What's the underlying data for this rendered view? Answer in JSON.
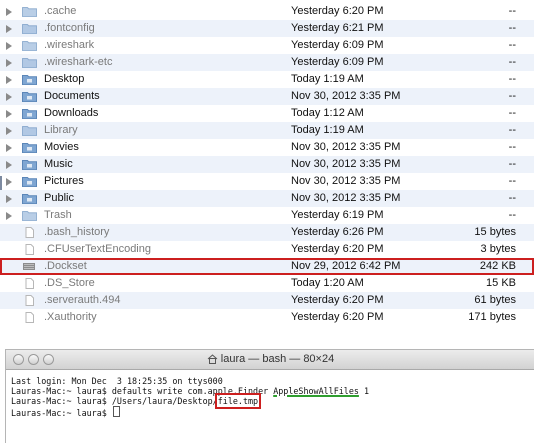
{
  "finder": {
    "rows": [
      {
        "name": ".cache",
        "date": "Yesterday 6:20 PM",
        "size": "--",
        "kind": "folder",
        "hidden": true
      },
      {
        "name": ".fontconfig",
        "date": "Yesterday 6:21 PM",
        "size": "--",
        "kind": "folder",
        "hidden": true
      },
      {
        "name": ".wireshark",
        "date": "Yesterday 6:09 PM",
        "size": "--",
        "kind": "folder",
        "hidden": true
      },
      {
        "name": ".wireshark-etc",
        "date": "Yesterday 6:09 PM",
        "size": "--",
        "kind": "folder",
        "hidden": true
      },
      {
        "name": "Desktop",
        "date": "Today 1:19 AM",
        "size": "--",
        "kind": "special-folder",
        "hidden": false
      },
      {
        "name": "Documents",
        "date": "Nov 30, 2012 3:35 PM",
        "size": "--",
        "kind": "special-folder",
        "hidden": false
      },
      {
        "name": "Downloads",
        "date": "Today 1:12 AM",
        "size": "--",
        "kind": "special-folder",
        "hidden": false
      },
      {
        "name": "Library",
        "date": "Today 1:19 AM",
        "size": "--",
        "kind": "folder",
        "hidden": true
      },
      {
        "name": "Movies",
        "date": "Nov 30, 2012 3:35 PM",
        "size": "--",
        "kind": "special-folder",
        "hidden": false
      },
      {
        "name": "Music",
        "date": "Nov 30, 2012 3:35 PM",
        "size": "--",
        "kind": "special-folder",
        "hidden": false
      },
      {
        "name": "Pictures",
        "date": "Nov 30, 2012 3:35 PM",
        "size": "--",
        "kind": "special-folder",
        "hidden": false
      },
      {
        "name": "Public",
        "date": "Nov 30, 2012 3:35 PM",
        "size": "--",
        "kind": "special-folder",
        "hidden": false
      },
      {
        "name": "Trash",
        "date": "Yesterday 6:19 PM",
        "size": "--",
        "kind": "folder",
        "hidden": true
      },
      {
        "name": ".bash_history",
        "date": "Yesterday 6:26 PM",
        "size": "15 bytes",
        "kind": "file",
        "hidden": true
      },
      {
        "name": ".CFUserTextEncoding",
        "date": "Yesterday 6:20 PM",
        "size": "3 bytes",
        "kind": "file",
        "hidden": true
      },
      {
        "name": ".Dockset",
        "date": "Nov 29, 2012 6:42 PM",
        "size": "242 KB",
        "kind": "db-file",
        "hidden": true,
        "highlighted": true
      },
      {
        "name": ".DS_Store",
        "date": "Today 1:20 AM",
        "size": "15 KB",
        "kind": "file",
        "hidden": true
      },
      {
        "name": ".serverauth.494",
        "date": "Yesterday 6:20 PM",
        "size": "61 bytes",
        "kind": "file",
        "hidden": true
      },
      {
        "name": ".Xauthority",
        "date": "Yesterday 6:20 PM",
        "size": "171 bytes",
        "kind": "file",
        "hidden": true
      }
    ]
  },
  "terminal": {
    "title": "laura — bash — 80×24",
    "title_icon": "home-icon",
    "lines": {
      "login": "Last login: Mon Dec  3 18:25:35 on ttys000",
      "cmd1_prefix": "Lauras-Mac:~ laura$ defaults write com.apple.Finder ",
      "cmd1_flag": "AppleShowAllFiles",
      "cmd1_suffix": " 1",
      "cmd2_prefix": "Lauras-Mac:~ laura$ /Users/laura/Desktop/",
      "cmd2_file": "file.tmp",
      "prompt": "Lauras-Mac:~ laura$ "
    }
  },
  "colors": {
    "highlight_box": "#cc1f1f",
    "underline": "#2f9e2f",
    "folder_blue": "#7fa6d2",
    "row_stripe": "#edf2fa"
  }
}
